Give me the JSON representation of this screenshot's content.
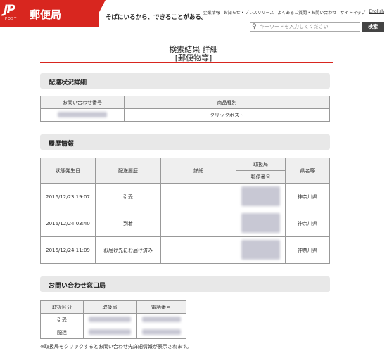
{
  "header": {
    "logo_mark": "JP",
    "logo_post": "POST",
    "logo_name": "郵便局",
    "tagline": "そばにいるから、できることがある。",
    "nav": [
      "企業情報",
      "お知らせ・プレスリリース",
      "よくあるご質問・お問い合わせ",
      "サイトマップ",
      "English"
    ],
    "search_placeholder": "キーワードを入力してください",
    "search_button": "検索"
  },
  "title": {
    "line1": "検索結果 詳細",
    "line2": "[郵便物等]"
  },
  "delivery_status": {
    "heading": "配達状況詳細",
    "columns": [
      "お問い合わせ番号",
      "商品種別"
    ],
    "row": {
      "number": "",
      "product": "クリックポスト"
    }
  },
  "history": {
    "heading": "履歴情報",
    "columns": [
      "状態発生日",
      "配送履歴",
      "詳細",
      "取扱局",
      "郵便番号",
      "県名等"
    ],
    "rows": [
      {
        "date": "2016/12/23 19:07",
        "status": "引受",
        "detail": "",
        "prefecture": "神奈川県"
      },
      {
        "date": "2016/12/24 03:40",
        "status": "到着",
        "detail": "",
        "prefecture": "神奈川県"
      },
      {
        "date": "2016/12/24 11:09",
        "status": "お届け先にお届け済み",
        "detail": "",
        "prefecture": "神奈川県"
      }
    ]
  },
  "contact": {
    "heading": "お問い合わせ窓口局",
    "columns": [
      "取扱区分",
      "取扱局",
      "電話番号"
    ],
    "rows": [
      {
        "type": "引受"
      },
      {
        "type": "配達"
      }
    ]
  },
  "note": "※取扱局をクリックするとお問い合わせ先詳細情報が表示されます。"
}
